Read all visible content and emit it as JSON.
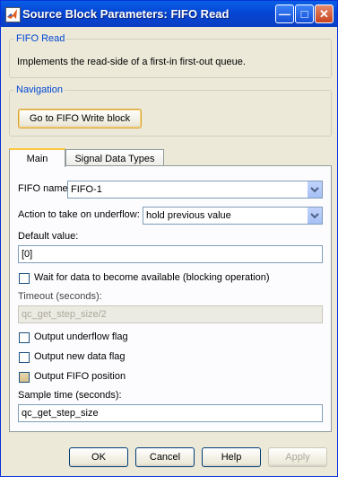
{
  "window": {
    "title": "Source Block Parameters: FIFO Read"
  },
  "block_group": {
    "label": "FIFO Read",
    "description": "Implements the read-side of a first-in first-out queue."
  },
  "navigation": {
    "label": "Navigation",
    "goto_button": "Go to FIFO Write block"
  },
  "tabs": [
    {
      "label": "Main",
      "active": true
    },
    {
      "label": "Signal Data Types",
      "active": false
    }
  ],
  "main": {
    "fifo_name_label": "FIFO name:",
    "fifo_name_value": "FIFO-1",
    "underflow_label": "Action to take on underflow:",
    "underflow_value": "hold previous value",
    "default_value_label": "Default value:",
    "default_value": "[0]",
    "wait_label": "Wait for data to become available (blocking operation)",
    "timeout_label": "Timeout (seconds):",
    "timeout_value": "qc_get_step_size/2",
    "underflow_flag_label": "Output underflow flag",
    "new_data_flag_label": "Output new data flag",
    "fifo_position_label": "Output FIFO position",
    "sample_time_label": "Sample time (seconds):",
    "sample_time_value": "qc_get_step_size"
  },
  "buttons": {
    "ok": "OK",
    "cancel": "Cancel",
    "help": "Help",
    "apply": "Apply"
  }
}
